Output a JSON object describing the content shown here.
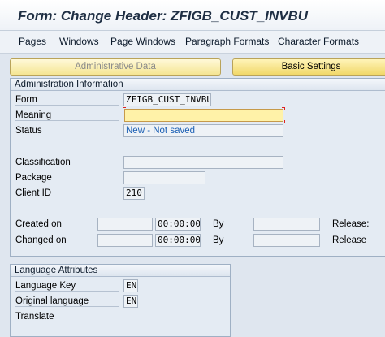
{
  "window": {
    "title": "Form: Change Header: ZFIGB_CUST_INVBU"
  },
  "menu": [
    "Pages",
    "Windows",
    "Page Windows",
    "Paragraph Formats",
    "Character Formats"
  ],
  "tabs": {
    "administrative": "Administrative Data",
    "basic": "Basic Settings"
  },
  "admin_info": {
    "header": "Administration Information",
    "form_label": "Form",
    "form_value": "ZFIGB_CUST_INVBU",
    "meaning_label": "Meaning",
    "meaning_value": "",
    "status_label": "Status",
    "status_value": "New - Not saved",
    "classification_label": "Classification",
    "classification_value": "",
    "package_label": "Package",
    "package_value": "",
    "client_label": "Client ID",
    "client_value": "210",
    "created_label": "Created on",
    "created_date": "",
    "created_time": "00:00:00",
    "created_by_label": "By",
    "created_by": "",
    "created_release_label": "Release:",
    "changed_label": "Changed on",
    "changed_date": "",
    "changed_time": "00:00:00",
    "changed_by_label": "By",
    "changed_by": "",
    "changed_release_label": "Release"
  },
  "language": {
    "header": "Language Attributes",
    "key_label": "Language Key",
    "key_value": "EN",
    "original_label": "Original language",
    "original_value": "EN",
    "translate_label": "Translate"
  }
}
